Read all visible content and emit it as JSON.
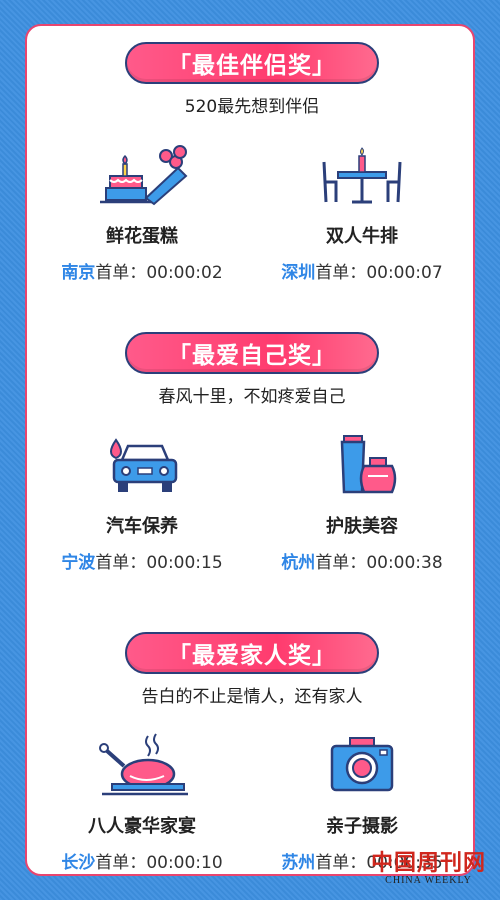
{
  "sections": [
    {
      "title": "「最佳伴侣奖」",
      "subtitle": "520最先想到伴侣",
      "items": [
        {
          "icon": "cake-flowers-icon",
          "name": "鲜花蛋糕",
          "city": "南京",
          "label": "首单：",
          "time": "00:00:02"
        },
        {
          "icon": "dinner-table-icon",
          "name": "双人牛排",
          "city": "深圳",
          "label": "首单：",
          "time": "00:00:07"
        }
      ]
    },
    {
      "title": "「最爱自己奖」",
      "subtitle": "春风十里，不如疼爱自己",
      "items": [
        {
          "icon": "car-wash-icon",
          "name": "汽车保养",
          "city": "宁波",
          "label": "首单：",
          "time": "00:00:15"
        },
        {
          "icon": "skincare-icon",
          "name": "护肤美容",
          "city": "杭州",
          "label": "首单：",
          "time": "00:00:38"
        }
      ]
    },
    {
      "title": "「最爱家人奖」",
      "subtitle": "告白的不止是情人，还有家人",
      "items": [
        {
          "icon": "roast-chicken-icon",
          "name": "八人豪华家宴",
          "city": "长沙",
          "label": "首单：",
          "time": "00:00:10"
        },
        {
          "icon": "camera-icon",
          "name": "亲子摄影",
          "city": "苏州",
          "label": "首单：",
          "time": "00:00:35"
        }
      ]
    }
  ],
  "watermark": {
    "title": "中国周刊网",
    "subtitle": "CHINA WEEKLY"
  },
  "colors": {
    "background": "#3d8fe0",
    "accent": "#ff3b6e",
    "city": "#2f86e6",
    "outline": "#2b3f7a"
  }
}
